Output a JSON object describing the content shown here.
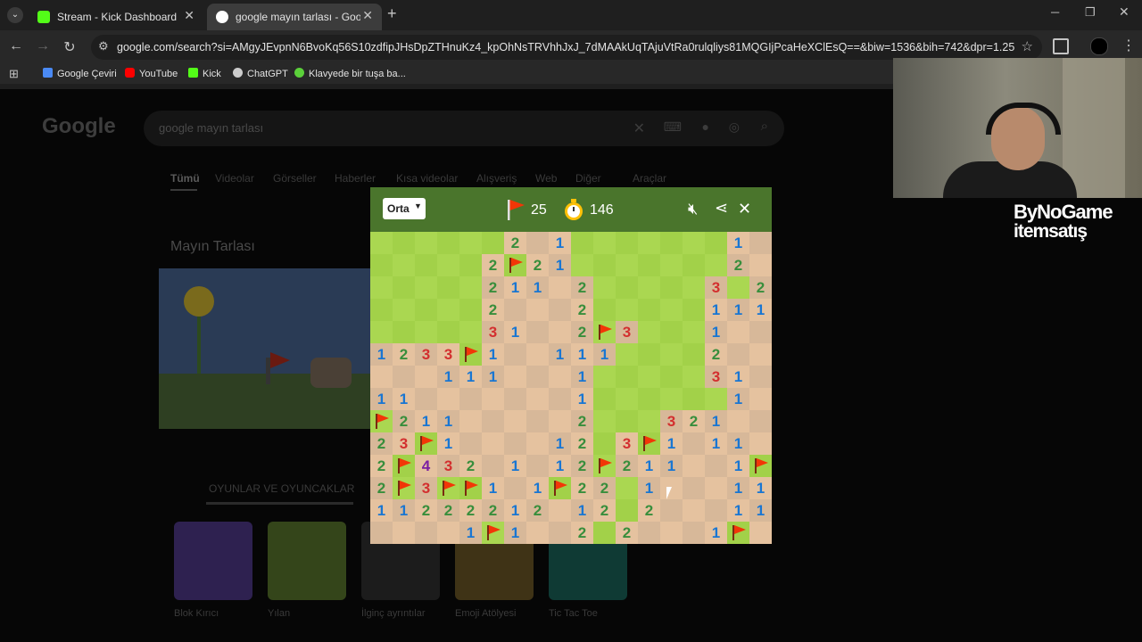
{
  "tabs": [
    {
      "title": "Stream - Kick Dashboard",
      "active": false
    },
    {
      "title": "google mayın tarlası - Google'da",
      "active": true
    }
  ],
  "new_tab_glyph": "+",
  "url": "google.com/search?si=AMgyJEvpnN6BvoKq56S10zdfipJHsDpZTHnuKz4_kpOhNsTRVhhJxJ_7dMAAkUqTAjuVtRa0rulqliys81MQGIjPcaHeXClEsQ==&biw=1536&bih=742&dpr=1.25",
  "bookmarks": [
    "Google Çeviri",
    "YouTube",
    "Kick",
    "ChatGPT",
    "Klavyede bir tuşa ba..."
  ],
  "search": {
    "logo": "Google",
    "query": "google mayın tarlası"
  },
  "filters": [
    "Tümü",
    "Videolar",
    "Görseller",
    "Haberler",
    "Kısa videolar",
    "Alışveriş",
    "Web",
    "Diğer",
    "Araçlar"
  ],
  "knowledge": {
    "title": "Mayın Tarlası",
    "games_heading": "OYUNLAR VE OYUNCAKLAR"
  },
  "games": [
    "Blok Kırıcı",
    "Yılan",
    "İlginç ayrıntılar",
    "Emoji Atölyesi",
    "Tic Tac Toe"
  ],
  "overlay": {
    "brand1": "ByNoGame",
    "brand2": "itemsatış"
  },
  "minesweeper": {
    "difficulty": "Orta",
    "flags_remaining": "25",
    "timer": "146",
    "sound": "muted",
    "colors": {
      "header": "#4a752c",
      "grass_light": "#aad751",
      "grass_dark": "#a2d149",
      "dirt_light": "#e5c29f",
      "dirt_dark": "#d7b899",
      "flag": "#f23607"
    },
    "number_colors": {
      "1": "#1976d2",
      "2": "#388e3c",
      "3": "#d32f2f",
      "4": "#7b1fa2"
    },
    "legend": "G = unrevealed, . = empty revealed, F = flag, digit = adjacent mines",
    "grid": [
      "GGGGGG2.1GGGGGGG1.",
      "GGGGG2F21GGGGGGG2.",
      "GGGGG211.2GGGGG3G2",
      "GGGGG2...2GGGGG111",
      "GGGGG31..2F3GGG1..",
      "1233F1..111GGGG2..",
      "...111...1GGGGG31.",
      "11.......1GGGGGG1.",
      "F211.....2GGG321..",
      "23F1....12G3F1.11.",
      "2F432.1.12F211..1F",
      "2F3FF1.1F22G1...11",
      "11222212.12G2...11",
      "....1F1..2G2...1F."
    ]
  }
}
